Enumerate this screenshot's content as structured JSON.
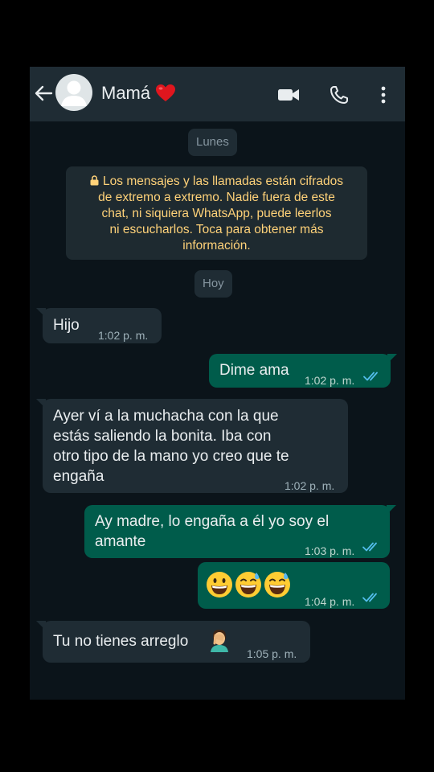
{
  "header": {
    "title": "Mamá",
    "back_icon": "arrow-left-icon",
    "avatar_icon": "default-avatar-icon",
    "heart_icon": "red-heart-emoji",
    "video_icon": "video-call-icon",
    "phone_icon": "phone-call-icon",
    "menu_icon": "more-vert-icon"
  },
  "chat": {
    "date_1": "Lunes",
    "encryption_notice": "Los mensajes y las llamadas están cifrados de extremo a extremo. Nadie fuera de este chat, ni siquiera WhatsApp, puede leerlos ni escucharlos. Toca para obtener más información.",
    "notice_line_1": "Los mensajes y las llamadas están cifrados",
    "notice_line_2": "de extremo a extremo. Nadie fuera de este",
    "notice_line_3": "chat, ni siquiera WhatsApp, puede leerlos",
    "notice_line_4": "ni escucharlos. Toca para obtener más",
    "notice_line_5": "información.",
    "date_2": "Hoy",
    "messages": [
      {
        "from": "contact",
        "text": "Hijo",
        "time": "1:02 p. m."
      },
      {
        "from": "me",
        "text": "Dime ama",
        "time": "1:02 p. m.",
        "status": "read"
      },
      {
        "from": "contact",
        "text": "Ayer ví a la muchacha con la que estás saliendo la bonita. Iba con otro tipo de la mano yo creo que te engaña",
        "time": "1:02 p. m.",
        "lines": [
          "Ayer ví a la muchacha con la que",
          "estás saliendo la bonita. Iba con",
          "otro tipo de la mano yo creo que te",
          "engaña"
        ]
      },
      {
        "from": "me",
        "text": "Ay madre, lo engaña a él yo soy el amante",
        "time": "1:03 p. m.",
        "status": "read",
        "lines": [
          "Ay madre, lo engaña a él yo soy el",
          "amante"
        ]
      },
      {
        "from": "me",
        "emojis": [
          "grinning-face",
          "grinning-sweat-face",
          "grinning-sweat-face"
        ],
        "time": "1:04 p. m.",
        "status": "read"
      },
      {
        "from": "contact",
        "text": "Tu no tienes arreglo",
        "emoji": "person-facepalming",
        "time": "1:05 p. m."
      }
    ]
  },
  "colors": {
    "background": "#0b141a",
    "header": "#1f2c34",
    "incoming_bubble": "#1f2c34",
    "outgoing_bubble": "#005c4b",
    "read_ticks": "#53bdeb",
    "notice_text": "#ffd279"
  }
}
